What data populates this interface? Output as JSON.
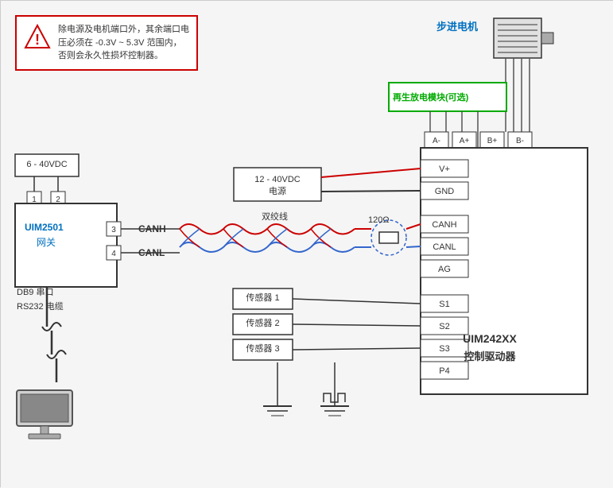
{
  "warning": {
    "text": "除电源及电机端口外，其余端口电压必须在 -0.3V ~ 5.3V 范围内，否则会永久性损坏控制器。"
  },
  "stepper": {
    "label": "步进电机"
  },
  "regen_module": {
    "label": "再生放电模块(可选)"
  },
  "power_left": {
    "label": "6 - 40VDC"
  },
  "gateway": {
    "model": "UIM2501",
    "role": "网关",
    "port1": "1",
    "port2": "2",
    "port3": "3",
    "port4": "4"
  },
  "db9": {
    "label": "DB9 串口"
  },
  "rs232": {
    "label": "RS232 电缆"
  },
  "power_main": {
    "line1": "12 - 40VDC",
    "line2": "电源"
  },
  "twisted_pair": {
    "label": "双绞线"
  },
  "canh": {
    "label": "CANH"
  },
  "canl": {
    "label": "CANL"
  },
  "resistor": {
    "label": "120Ω"
  },
  "driver_box": {
    "terminals": [
      "V+",
      "GND",
      "CANH",
      "CANL",
      "AG",
      "S1",
      "S2",
      "S3",
      "P4"
    ],
    "motor_pins": [
      "A-",
      "A+",
      "B+",
      "B-"
    ],
    "model": "UIM242XX",
    "role": "控制驱动器"
  },
  "sensors": [
    {
      "label": "传感器 1",
      "pin": "S1"
    },
    {
      "label": "传感器 2",
      "pin": "S2"
    },
    {
      "label": "传感器 3",
      "pin": "S3"
    }
  ]
}
